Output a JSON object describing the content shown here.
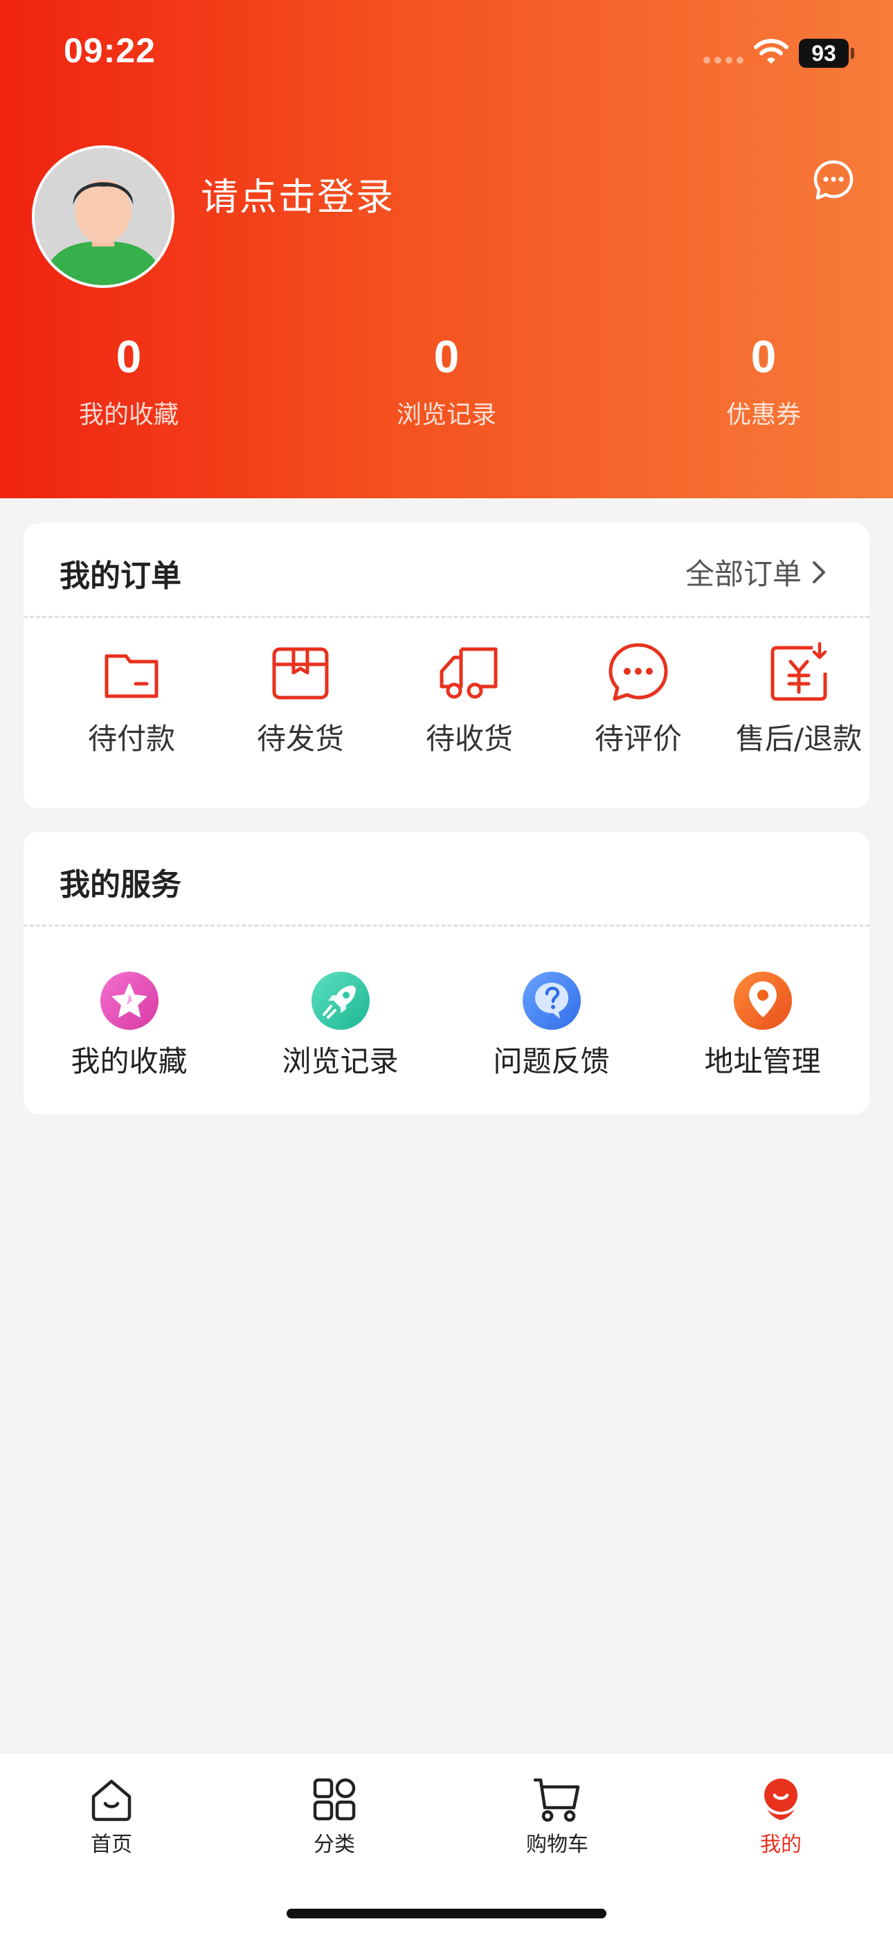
{
  "status_bar": {
    "time": "09:22",
    "battery": "93"
  },
  "header": {
    "login_prompt": "请点击登录",
    "stats": [
      {
        "value": "0",
        "label": "我的收藏"
      },
      {
        "value": "0",
        "label": "浏览记录"
      },
      {
        "value": "0",
        "label": "优惠券"
      }
    ]
  },
  "orders": {
    "title": "我的订单",
    "all_link": "全部订单",
    "items": [
      {
        "label": "待付款",
        "icon": "wallet-icon"
      },
      {
        "label": "待发货",
        "icon": "package-icon"
      },
      {
        "label": "待收货",
        "icon": "truck-icon"
      },
      {
        "label": "待评价",
        "icon": "comment-icon"
      },
      {
        "label": "售后/退款",
        "icon": "refund-icon"
      }
    ]
  },
  "services": {
    "title": "我的服务",
    "items": [
      {
        "label": "我的收藏",
        "icon": "star-icon",
        "color": "#e94bb4"
      },
      {
        "label": "浏览记录",
        "icon": "rocket-icon",
        "color": "#2fc9a6"
      },
      {
        "label": "问题反馈",
        "icon": "question-icon",
        "color": "#3f7ff1"
      },
      {
        "label": "地址管理",
        "icon": "location-pin-icon",
        "color": "#f0641e"
      }
    ]
  },
  "tabbar": {
    "items": [
      {
        "label": "首页",
        "icon": "home-icon"
      },
      {
        "label": "分类",
        "icon": "category-grid-icon"
      },
      {
        "label": "购物车",
        "icon": "cart-icon"
      },
      {
        "label": "我的",
        "icon": "profile-icon",
        "active": true
      }
    ]
  },
  "colors": {
    "accent": "#e8321e",
    "header_start": "#f02311",
    "header_end": "#f77c3a"
  }
}
